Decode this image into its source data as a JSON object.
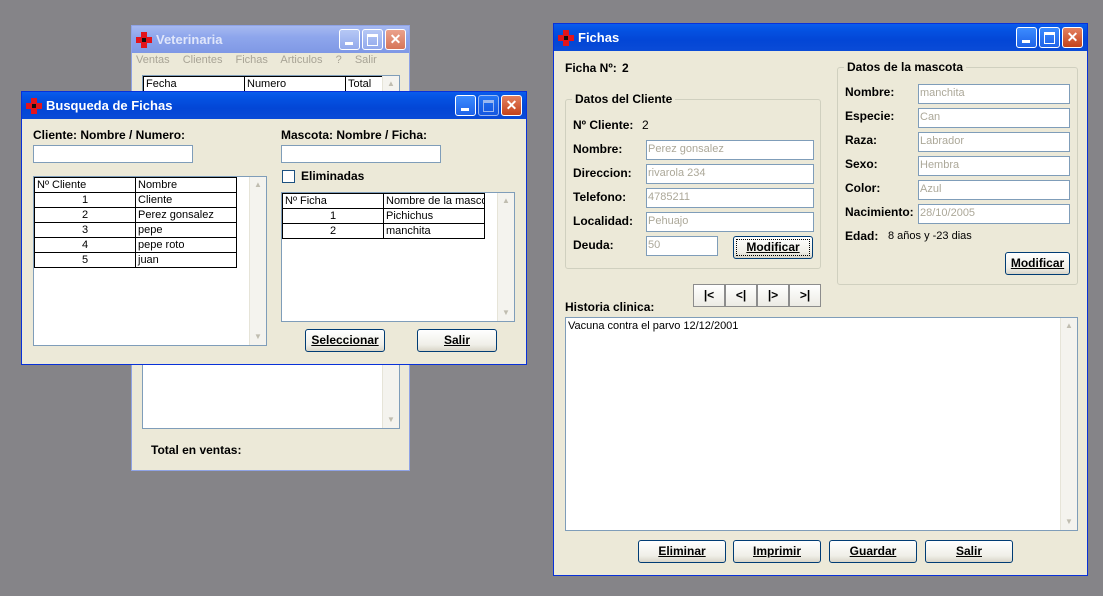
{
  "veterinaria": {
    "title": "Veterinaria",
    "menu": [
      "Ventas",
      "Clientes",
      "Fichas",
      "Articulos",
      "?",
      "Salir"
    ],
    "columns": [
      "Fecha",
      "Numero",
      "Total"
    ],
    "total_label": "Total en ventas:"
  },
  "busqueda": {
    "title": "Busqueda de Fichas",
    "cliente_label": "Cliente: Nombre / Numero:",
    "cliente_value": "",
    "mascota_label": "Mascota: Nombre / Ficha:",
    "mascota_value": "",
    "eliminadas_label": "Eliminadas",
    "clientes_columns": [
      "Nº Cliente",
      "Nombre"
    ],
    "clientes_rows": [
      [
        "1",
        "Cliente"
      ],
      [
        "2",
        "Perez gonsalez"
      ],
      [
        "3",
        "pepe"
      ],
      [
        "4",
        "pepe roto"
      ],
      [
        "5",
        "juan"
      ]
    ],
    "fichas_columns": [
      "Nº Ficha",
      "Nombre de la mascota"
    ],
    "fichas_rows": [
      [
        "1",
        "Pichichus"
      ],
      [
        "2",
        "manchita"
      ]
    ],
    "seleccionar_label": "Seleccionar",
    "salir_label": "Salir"
  },
  "fichas": {
    "title": "Fichas",
    "ficha_label": "Ficha Nº:",
    "ficha_num": "2",
    "cliente_group": "Datos del Cliente",
    "n_cliente_label": "Nº Cliente:",
    "n_cliente_value": "2",
    "nombre_label": "Nombre:",
    "nombre_value": "Perez gonsalez",
    "direccion_label": "Direccion:",
    "direccion_value": "rivarola 234",
    "telefono_label": "Telefono:",
    "telefono_value": "4785211",
    "localidad_label": "Localidad:",
    "localidad_value": "Pehuajo",
    "deuda_label": "Deuda:",
    "deuda_value": "50",
    "modificar_label": "Modificar",
    "mascota_group": "Datos de la mascota",
    "m_nombre_label": "Nombre:",
    "m_nombre_value": "manchita",
    "especie_label": "Especie:",
    "especie_value": "Can",
    "raza_label": "Raza:",
    "raza_value": "Labrador",
    "sexo_label": "Sexo:",
    "sexo_value": "Hembra",
    "color_label": "Color:",
    "color_value": "Azul",
    "nacimiento_label": "Nacimiento:",
    "nacimiento_value": "28/10/2005",
    "edad_label": "Edad:",
    "edad_value": "8 años y -23 dias",
    "nav": [
      "|<",
      "<|",
      "|>",
      ">|"
    ],
    "historia_label": "Historia clinica:",
    "historia_text": "Vacuna contra el parvo 12/12/2001",
    "eliminar_label": "Eliminar",
    "imprimir_label": "Imprimir",
    "guardar_label": "Guardar",
    "salir_label": "Salir"
  }
}
